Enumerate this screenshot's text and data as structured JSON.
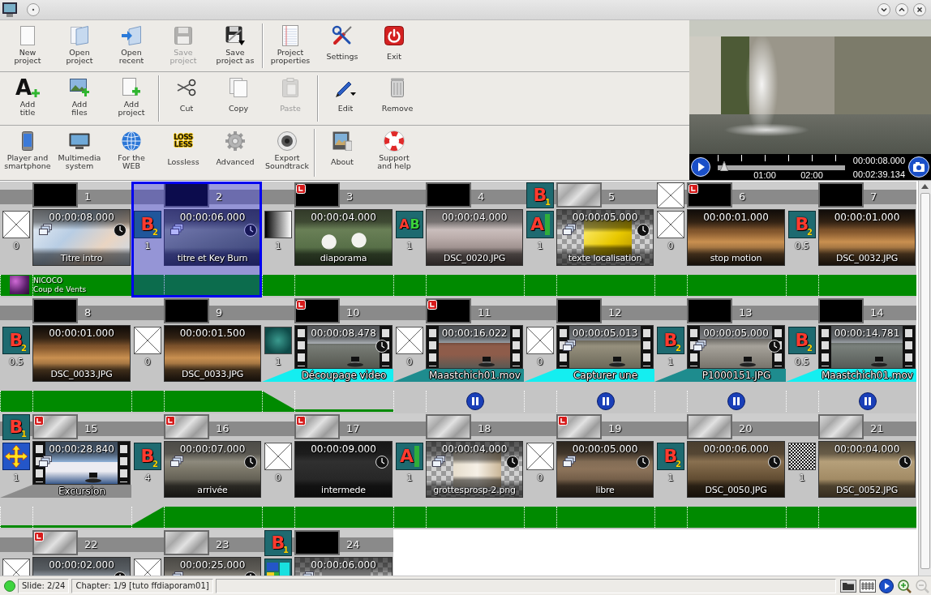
{
  "toolbar": {
    "rows": [
      {
        "groups": [
          [
            {
              "kind": "new",
              "label": "New\nproject",
              "disabled": false
            },
            {
              "kind": "open",
              "label": "Open\nproject",
              "disabled": false
            },
            {
              "kind": "recent",
              "label": "Open\nrecent",
              "disabled": false
            },
            {
              "kind": "save",
              "label": "Save\nproject",
              "disabled": true
            },
            {
              "kind": "saveas",
              "label": "Save\nproject as",
              "disabled": false
            }
          ],
          [
            {
              "kind": "properties",
              "label": "Project\nproperties",
              "disabled": false
            },
            {
              "kind": "settings",
              "label": "Settings",
              "disabled": false
            },
            {
              "kind": "exit",
              "label": "Exit",
              "disabled": false
            }
          ]
        ]
      },
      {
        "groups": [
          [
            {
              "kind": "title",
              "label": "Add\ntitle",
              "icon_text": "A",
              "disabled": false
            },
            {
              "kind": "files",
              "label": "Add\nfiles",
              "disabled": false
            },
            {
              "kind": "project",
              "label": "Add\nproject",
              "disabled": false
            }
          ],
          [
            {
              "kind": "cut",
              "label": "Cut",
              "disabled": false
            },
            {
              "kind": "copy",
              "label": "Copy",
              "disabled": false
            },
            {
              "kind": "paste",
              "label": "Paste",
              "disabled": true
            }
          ],
          [
            {
              "kind": "edit",
              "label": "Edit",
              "disabled": false
            },
            {
              "kind": "remove",
              "label": "Remove",
              "disabled": false
            }
          ]
        ]
      },
      {
        "groups": [
          [
            {
              "kind": "player",
              "label": "Player and\nsmartphone",
              "disabled": false
            },
            {
              "kind": "multimedia",
              "label": "Multimedia\nsystem",
              "disabled": false
            },
            {
              "kind": "web",
              "label": "For the\nWEB",
              "disabled": false
            },
            {
              "kind": "lossless",
              "label": "Lossless",
              "icon_text": "LOSS\nLESS",
              "disabled": false
            },
            {
              "kind": "advanced",
              "label": "Advanced",
              "disabled": false
            },
            {
              "kind": "soundtrack",
              "label": "Export\nSoundtrack",
              "disabled": false
            }
          ],
          [
            {
              "kind": "about",
              "label": "About",
              "disabled": false
            },
            {
              "kind": "support",
              "label": "Support\nand help",
              "disabled": false
            }
          ]
        ]
      }
    ]
  },
  "preview": {
    "playhead": {
      "level": 0.05
    },
    "scale_labels": [
      "01:00",
      "02:00"
    ],
    "position": "00:00:08.000",
    "duration": "00:02:39.134"
  },
  "timeline": {
    "rows": [
      {
        "slides": [
          {
            "number": "1",
            "selected": false,
            "chapter": false,
            "background": {
              "kind": "black"
            },
            "transition": {
              "kind": "cross",
              "duration": "0"
            },
            "thumb": {
              "kind": "photo",
              "time": "00:00:08.000",
              "name": "Titre intro",
              "layers": true,
              "clock": true
            },
            "music": {
              "kind": "full",
              "artist": "NICOCO",
              "title": "Coup de Vents"
            }
          },
          {
            "number": "2",
            "selected": true,
            "chapter": false,
            "background": {
              "kind": "black"
            },
            "transition": {
              "kind": "letter",
              "letters": [
                "B"
              ],
              "index": "2",
              "duration": "1"
            },
            "thumb": {
              "kind": "photo",
              "time": "00:00:06.000",
              "name": "titre et Key Burn",
              "layers": true,
              "clock": true
            },
            "music": {
              "kind": "full"
            }
          },
          {
            "number": "3",
            "selected": false,
            "chapter": true,
            "background": {
              "kind": "black"
            },
            "transition": {
              "kind": "gradient",
              "duration": "1"
            },
            "thumb": {
              "kind": "photo",
              "time": "00:00:04.000",
              "name": "diaporama",
              "layers": false,
              "clock": false
            },
            "music": {
              "kind": "full"
            }
          },
          {
            "number": "4",
            "selected": false,
            "chapter": false,
            "background": {
              "kind": "black"
            },
            "transition": {
              "kind": "letter",
              "letters": [
                "A",
                "B"
              ],
              "duration": "1"
            },
            "thumb": {
              "kind": "photo",
              "time": "00:00:04.000",
              "name": "DSC_0020.JPG",
              "layers": false,
              "clock": false
            },
            "music": {
              "kind": "full"
            }
          },
          {
            "number": "5",
            "selected": false,
            "chapter": false,
            "bg_transition": {
              "kind": "letter",
              "letters": [
                "B"
              ],
              "index": "1"
            },
            "background": {
              "kind": "texture"
            },
            "transition": {
              "kind": "letter_bar",
              "letters": [
                "A"
              ],
              "duration": "1"
            },
            "thumb": {
              "kind": "checker",
              "time": "00:00:05.000",
              "name": "texte localisation",
              "layers": true,
              "clock": true
            },
            "music": {
              "kind": "full"
            }
          },
          {
            "number": "6",
            "selected": false,
            "chapter": true,
            "bg_transition": {
              "kind": "cross"
            },
            "background": {
              "kind": "black"
            },
            "transition": {
              "kind": "cross",
              "duration": "0"
            },
            "thumb": {
              "kind": "photo",
              "time": "00:00:01.000",
              "name": "stop motion",
              "layers": false,
              "clock": false
            },
            "music": {
              "kind": "full"
            }
          },
          {
            "number": "7",
            "selected": false,
            "chapter": false,
            "background": {
              "kind": "black"
            },
            "transition": {
              "kind": "letter",
              "letters": [
                "B"
              ],
              "index": "2",
              "duration": "0.5"
            },
            "thumb": {
              "kind": "photo",
              "time": "00:00:01.000",
              "name": "DSC_0032.JPG",
              "layers": false,
              "clock": false
            },
            "music": {
              "kind": "full"
            }
          }
        ]
      },
      {
        "slides": [
          {
            "number": "8",
            "selected": false,
            "chapter": false,
            "background": {
              "kind": "black"
            },
            "transition": {
              "kind": "letter",
              "letters": [
                "B"
              ],
              "index": "2",
              "duration": "0.5"
            },
            "thumb": {
              "kind": "photo",
              "time": "00:00:01.000",
              "name": "DSC_0033.JPG",
              "layers": false,
              "clock": false
            },
            "music": {
              "kind": "full"
            }
          },
          {
            "number": "9",
            "selected": false,
            "chapter": false,
            "background": {
              "kind": "black"
            },
            "transition": {
              "kind": "cross",
              "duration": "0"
            },
            "thumb": {
              "kind": "photo",
              "time": "00:00:01.500",
              "name": "DSC_0033.JPG",
              "layers": false,
              "clock": false
            },
            "music": {
              "kind": "full"
            }
          },
          {
            "number": "10",
            "selected": false,
            "chapter": true,
            "background": {
              "kind": "black"
            },
            "transition": {
              "kind": "blur",
              "duration": "1"
            },
            "thumb": {
              "kind": "video",
              "time": "00:00:08.478",
              "name": "Découpage video",
              "layers": false,
              "clock": true
            },
            "audio": {
              "color": "#14eef0"
            },
            "music": {
              "kind": "fade_out"
            }
          },
          {
            "number": "11",
            "selected": false,
            "chapter": true,
            "background": {
              "kind": "black"
            },
            "transition": {
              "kind": "cross",
              "duration": "0"
            },
            "thumb": {
              "kind": "video",
              "time": "00:00:16.022",
              "name": "Maastchich01.mov",
              "layers": false,
              "clock": false
            },
            "audio": {
              "color": "#1e8c8e"
            },
            "music": {
              "kind": "paused"
            }
          },
          {
            "number": "12",
            "selected": false,
            "chapter": false,
            "background": {
              "kind": "black"
            },
            "transition": {
              "kind": "cross",
              "duration": "0"
            },
            "thumb": {
              "kind": "video",
              "time": "00:00:05.013",
              "name": "Capturer une",
              "layers": true,
              "clock": false
            },
            "audio": {
              "color": "#14eef0"
            },
            "music": {
              "kind": "paused"
            }
          },
          {
            "number": "13",
            "selected": false,
            "chapter": false,
            "background": {
              "kind": "black"
            },
            "transition": {
              "kind": "letter",
              "letters": [
                "B"
              ],
              "index": "2",
              "duration": "1"
            },
            "thumb": {
              "kind": "video",
              "time": "00:00:05.000",
              "name": "P1000151.JPG",
              "layers": true,
              "clock": true
            },
            "audio": {
              "color": "#1e8c8e"
            },
            "music": {
              "kind": "paused"
            }
          },
          {
            "number": "14",
            "selected": false,
            "chapter": false,
            "background": {
              "kind": "black"
            },
            "transition": {
              "kind": "letter",
              "letters": [
                "B"
              ],
              "index": "2",
              "duration": "0.5"
            },
            "thumb": {
              "kind": "video",
              "time": "00:00:14.781",
              "name": "Maastchich01.mov",
              "layers": false,
              "clock": false
            },
            "audio": {
              "color": "#14eef0"
            },
            "music": {
              "kind": "paused"
            }
          }
        ]
      },
      {
        "slides": [
          {
            "number": "15",
            "selected": false,
            "chapter": true,
            "bg_transition": {
              "kind": "letter",
              "letters": [
                "B"
              ],
              "index": "1"
            },
            "background": {
              "kind": "texture"
            },
            "transition": {
              "kind": "arrows",
              "duration": "1"
            },
            "thumb": {
              "kind": "video",
              "time": "00:00:28.840",
              "name": "Excursion",
              "layers": true,
              "clock": false
            },
            "audio": {
              "color": "#8c8c8c"
            },
            "music": {
              "kind": "low"
            }
          },
          {
            "number": "16",
            "selected": false,
            "chapter": true,
            "background": {
              "kind": "texture"
            },
            "transition": {
              "kind": "letter",
              "letters": [
                "B"
              ],
              "index": "2",
              "duration": "4"
            },
            "thumb": {
              "kind": "photo",
              "time": "00:00:07.000",
              "name": "arrivée",
              "layers": true,
              "clock": true
            },
            "music": {
              "kind": "fade_in"
            }
          },
          {
            "number": "17",
            "selected": false,
            "chapter": true,
            "background": {
              "kind": "texture"
            },
            "transition": {
              "kind": "cross",
              "duration": "0"
            },
            "thumb": {
              "kind": "photo",
              "time": "00:00:09.000",
              "name": "intermede",
              "layers": false,
              "clock": true
            },
            "music": {
              "kind": "full"
            }
          },
          {
            "number": "18",
            "selected": false,
            "chapter": false,
            "background": {
              "kind": "texture"
            },
            "transition": {
              "kind": "letter_bar",
              "letters": [
                "A"
              ],
              "duration": "1"
            },
            "thumb": {
              "kind": "checker",
              "time": "00:00:04.000",
              "name": "grottesprosp-2.png",
              "layers": true,
              "clock": true
            },
            "music": {
              "kind": "full"
            }
          },
          {
            "number": "19",
            "selected": false,
            "chapter": true,
            "background": {
              "kind": "texture"
            },
            "transition": {
              "kind": "cross",
              "duration": "0"
            },
            "thumb": {
              "kind": "photo",
              "time": "00:00:05.000",
              "name": "libre",
              "layers": true,
              "clock": true
            },
            "music": {
              "kind": "full"
            }
          },
          {
            "number": "20",
            "selected": false,
            "chapter": false,
            "background": {
              "kind": "texture"
            },
            "transition": {
              "kind": "letter",
              "letters": [
                "B"
              ],
              "index": "2",
              "duration": "1"
            },
            "thumb": {
              "kind": "photo",
              "time": "00:00:06.000",
              "name": "DSC_0050.JPG",
              "layers": false,
              "clock": true
            },
            "music": {
              "kind": "full"
            }
          },
          {
            "number": "21",
            "selected": false,
            "chapter": false,
            "background": {
              "kind": "texture"
            },
            "transition": {
              "kind": "noise",
              "duration": "1"
            },
            "thumb": {
              "kind": "photo",
              "time": "00:00:04.000",
              "name": "DSC_0052.JPG",
              "layers": false,
              "clock": true
            },
            "music": {
              "kind": "full"
            }
          }
        ]
      },
      {
        "slides": [
          {
            "number": "22",
            "selected": false,
            "chapter": true,
            "background": {
              "kind": "texture"
            },
            "transition": {
              "kind": "cross"
            },
            "thumb": {
              "kind": "photo",
              "time": "00:00:02.000",
              "layers": false,
              "clock": true
            }
          },
          {
            "number": "23",
            "selected": false,
            "chapter": false,
            "background": {
              "kind": "texture"
            },
            "transition": {
              "kind": "cross"
            },
            "thumb": {
              "kind": "photo",
              "time": "00:00:25.000",
              "layers": true,
              "clock": true
            }
          },
          {
            "number": "24",
            "selected": false,
            "chapter": false,
            "bg_transition": {
              "kind": "letter",
              "letters": [
                "B"
              ],
              "index": "1"
            },
            "background": {
              "kind": "black"
            },
            "transition": {
              "kind": "mosaic"
            },
            "thumb": {
              "kind": "checker",
              "time": "00:00:06.000",
              "layers": true,
              "clock": false
            }
          }
        ]
      }
    ]
  },
  "status_bar": {
    "slide": "Slide: 2/24",
    "chapter": "Chapter: 1/9 [tuto ffdiaporam01]",
    "tools": [
      {
        "kind": "folder",
        "disabled": false
      },
      {
        "kind": "grid",
        "disabled": false
      },
      {
        "kind": "play",
        "disabled": false
      },
      {
        "kind": "zoom_in",
        "disabled": false
      },
      {
        "kind": "zoom_out",
        "disabled": true
      }
    ]
  }
}
